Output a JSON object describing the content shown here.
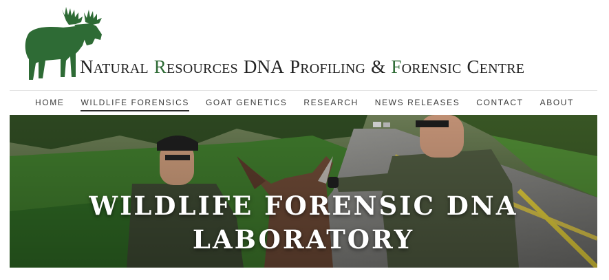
{
  "brand": {
    "logo_icon": "moose-icon",
    "title_words": [
      {
        "initial": "N",
        "rest": "ATURAL",
        "green": false
      },
      {
        "initial": "R",
        "rest": "ESOURCES",
        "green": true
      },
      {
        "initial": "DNA",
        "rest": "",
        "green": false
      },
      {
        "initial": "P",
        "rest": "ROFILING",
        "green": false
      },
      {
        "initial": "&",
        "rest": "",
        "green": false
      },
      {
        "initial": "F",
        "rest": "ORENSIC",
        "green": true
      },
      {
        "initial": "C",
        "rest": "ENTRE",
        "green": false
      }
    ],
    "colors": {
      "green": "#2e6b35",
      "text": "#222222"
    }
  },
  "nav": {
    "items": [
      {
        "label": "HOME",
        "active": false
      },
      {
        "label": "WILDLIFE FORENSICS",
        "active": true
      },
      {
        "label": "GOAT GENETICS",
        "active": false
      },
      {
        "label": "RESEARCH",
        "active": false
      },
      {
        "label": "NEWS RELEASES",
        "active": false
      },
      {
        "label": "CONTACT",
        "active": false
      },
      {
        "label": "ABOUT",
        "active": false
      }
    ]
  },
  "hero": {
    "title_line1": "WILDLIFE FORENSIC DNA",
    "title_line2": "LABORATORY"
  }
}
